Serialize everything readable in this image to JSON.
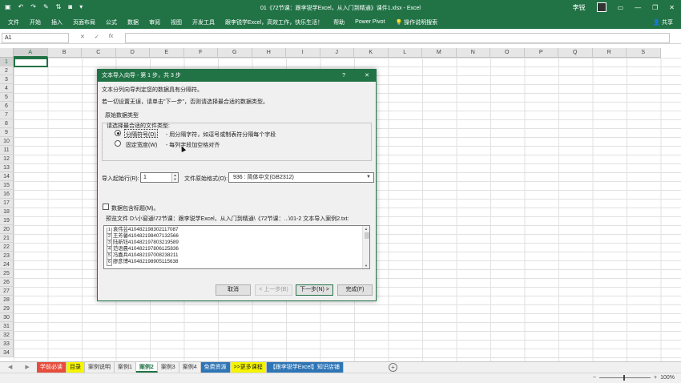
{
  "window": {
    "title": "01《72节课：跟李锐学Excel，从入门到精通》课件1.xlsx  -  Excel",
    "user": "李锐",
    "qat_icons": [
      "save-icon",
      "undo-icon",
      "redo-icon",
      "format-painter-icon",
      "sort-icon",
      "camera-icon",
      "customize-qat-icon"
    ]
  },
  "ribbon": {
    "tabs": [
      "文件",
      "开始",
      "插入",
      "页面布局",
      "公式",
      "数据",
      "审阅",
      "视图",
      "开发工具",
      "跟李锐学Excel，高效工作，快乐生活！",
      "帮助",
      "Power Pivot",
      "操作说明搜索"
    ],
    "share": "共享"
  },
  "formula_bar": {
    "name_box": "A1",
    "cancel": "✕",
    "enter": "✓",
    "fx": "fx",
    "value": ""
  },
  "grid": {
    "columns": [
      "A",
      "B",
      "C",
      "D",
      "E",
      "F",
      "G",
      "H",
      "I",
      "J",
      "K",
      "L",
      "M",
      "N",
      "O",
      "P",
      "Q",
      "R",
      "S"
    ],
    "rows": [
      "1",
      "2",
      "3",
      "4",
      "5",
      "6",
      "7",
      "8",
      "9",
      "10",
      "11",
      "12",
      "13",
      "14",
      "15",
      "16",
      "17",
      "18",
      "19",
      "20",
      "21",
      "22",
      "23",
      "24",
      "25",
      "26",
      "27",
      "28",
      "29",
      "30",
      "31",
      "32",
      "33",
      "34"
    ],
    "selected_cell": "A1"
  },
  "sheets": {
    "tabs": [
      {
        "label": "学前必读",
        "bg": "#e74c3c",
        "color": "#ffffff"
      },
      {
        "label": "目录",
        "bg": "#f5f500",
        "color": "#222222"
      },
      {
        "label": "案例说明",
        "bg": "",
        "color": "#333333"
      },
      {
        "label": "案例1",
        "bg": "",
        "color": "#333333"
      },
      {
        "label": "案例2",
        "bg": "#ffffff",
        "color": "#217346",
        "active": true
      },
      {
        "label": "案例3",
        "bg": "",
        "color": "#333333"
      },
      {
        "label": "案例4",
        "bg": "",
        "color": "#333333"
      },
      {
        "label": "免费资源",
        "bg": "#2e75b6",
        "color": "#ffffff"
      },
      {
        "label": ">>更多课程",
        "bg": "#f5f500",
        "color": "#222222"
      },
      {
        "label": "【跟李锐学Excel】知识店铺",
        "bg": "#2e75b6",
        "color": "#ffffff"
      }
    ],
    "add": "+"
  },
  "status": {
    "zoom": "100%",
    "minus": "−",
    "plus": "+"
  },
  "dialog": {
    "title": "文本导入向导 - 第 1 步，共 3 步",
    "help": "?",
    "close": "✕",
    "intro1": "文本分列向导判定您的数据具有分隔符。",
    "intro2": "若一切设置无误，请单击\"下一步\"，否则请选择最合适的数据类型。",
    "group_label": "原始数据类型",
    "choose_label": "请选择最合适的文件类型:",
    "opt1_label": "分隔符号(D)",
    "opt1_desc": "- 用分隔字符，如逗号或制表符分隔每个字段",
    "opt2_label": "固定宽度(W)",
    "opt2_desc": "- 每列字段加空格对齐",
    "start_row_label": "导入起始行(R):",
    "start_row_value": "1",
    "origin_label": "文件原始格式(O):",
    "origin_value": "936 : 简体中文(GB2312)",
    "header_label": "数据包含标题(M)。",
    "preview_label": "预览文件 D:\\小窗通\\72节课：跟李锐学Excel，从入门到精通\\《72节课：...\\01-2 文本导入案例2.txt:",
    "preview_rows": [
      {
        "n": "1",
        "text": "袁伟芸410482198302117087"
      },
      {
        "n": "2",
        "text": "王芳馨410482198407132566"
      },
      {
        "n": "3",
        "text": "陆新钰410482197803219589"
      },
      {
        "n": "4",
        "text": "范语晨410482197806125836"
      },
      {
        "n": "5",
        "text": "冯嘉兵410482197008238211"
      },
      {
        "n": "6",
        "text": "廖彦博410482198905115638"
      }
    ],
    "cancel": "取消",
    "back": "< 上一步(B)",
    "next": "下一步(N) >",
    "finish": "完成(F)"
  }
}
